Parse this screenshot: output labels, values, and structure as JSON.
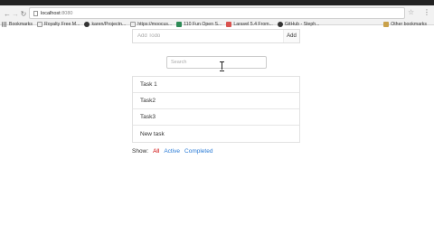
{
  "browser": {
    "url_host": "localhost",
    "url_port": ":8080",
    "bookmarks": [
      {
        "label": "Bookmarks",
        "icon": "apps-icon"
      },
      {
        "label": "Royalty Free M...",
        "icon": "doc-icon"
      },
      {
        "label": "karen/Projectn...",
        "icon": "github-icon"
      },
      {
        "label": "https://moocus...",
        "icon": "doc-icon"
      },
      {
        "label": "110 Fun Open S...",
        "icon": "green-icon"
      },
      {
        "label": "Laravel 5.4 From...",
        "icon": "red-icon"
      },
      {
        "label": "GitHub - Steph...",
        "icon": "github-icon"
      }
    ],
    "other_bookmarks": "Other bookmarks"
  },
  "todo": {
    "add_placeholder": "Add Todo",
    "add_button": "Add",
    "search_placeholder": "Search",
    "tasks": [
      "Task 1",
      "Task2",
      "Task3",
      "New task"
    ]
  },
  "filters": {
    "label": "Show:",
    "all": "All",
    "active": "Active",
    "completed": "Completed",
    "selected_color": "#cc0000",
    "link_color": "#2a7bd6"
  }
}
